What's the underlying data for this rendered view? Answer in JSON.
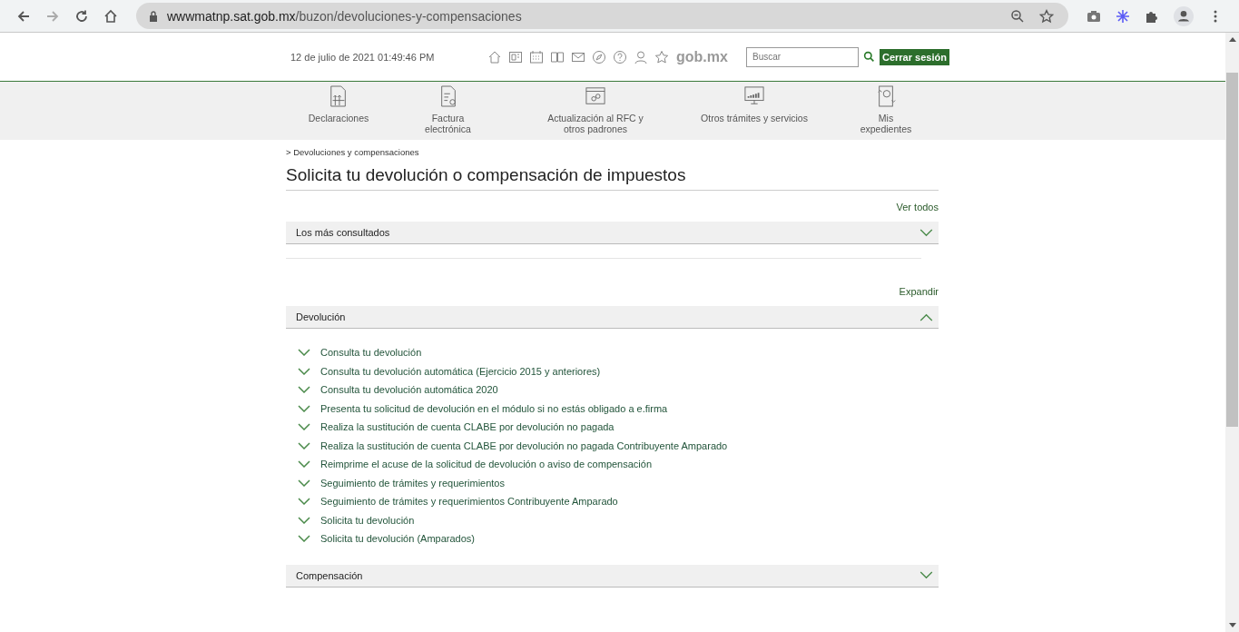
{
  "browser": {
    "url_host": "wwwmatnp.sat.gob.mx",
    "url_path": "/buzon/devoluciones-y-compensaciones"
  },
  "header": {
    "datetime": "12 de julio de 2021 01:49:46 PM",
    "brand": "gob.mx",
    "search": {
      "placeholder": "Buscar"
    },
    "logout": "Cerrar sesión"
  },
  "nav": [
    {
      "label": "Declaraciones"
    },
    {
      "label": "Factura electrónica"
    },
    {
      "label": "Actualización al RFC y otros padrones"
    },
    {
      "label": "Otros trámites y servicios"
    },
    {
      "label": "Mis expedientes"
    }
  ],
  "breadcrumb": "> Devoluciones y compensaciones",
  "title": "Solicita tu devolución o compensación de impuestos",
  "groups": [
    {
      "link": "Ver todos",
      "sections": [
        {
          "title": "Los más consultados",
          "expanded": false
        }
      ]
    },
    {
      "link": "Expandir",
      "sections": [
        {
          "title": "Devolución",
          "expanded": true,
          "items": [
            "Consulta tu devolución",
            "Consulta tu devolución automática (Ejercicio 2015 y anteriores)",
            "Consulta tu devolución automática 2020",
            "Presenta tu solicitud de devolución en el módulo si no estás obligado a e.firma",
            "Realiza la sustitución de cuenta CLABE por devolución no pagada",
            "Realiza la sustitución de cuenta CLABE por devolución no pagada Contribuyente Amparado",
            "Reimprime el acuse de la solicitud de devolución o aviso de compensación",
            "Seguimiento de trámites y requerimientos",
            "Seguimiento de trámites y requerimientos Contribuyente Amparado",
            "Solicita tu devolución",
            "Solicita tu devolución (Amparados)"
          ]
        },
        {
          "title": "Compensación",
          "expanded": false
        }
      ]
    }
  ]
}
